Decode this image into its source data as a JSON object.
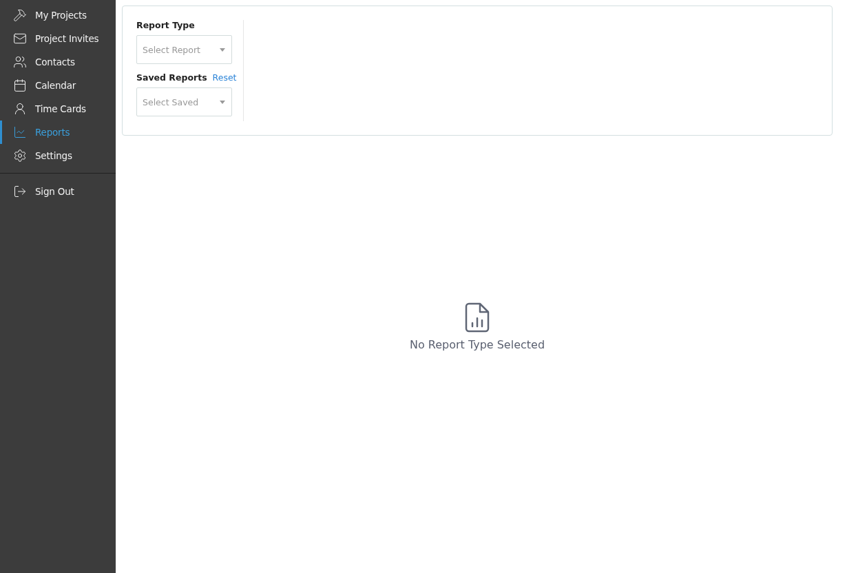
{
  "sidebar": {
    "items": [
      {
        "label": "My Projects",
        "selected": false
      },
      {
        "label": "Project Invites",
        "selected": false
      },
      {
        "label": "Contacts",
        "selected": false
      },
      {
        "label": "Calendar",
        "selected": false
      },
      {
        "label": "Time Cards",
        "selected": false
      },
      {
        "label": "Reports",
        "selected": true
      },
      {
        "label": "Settings",
        "selected": false
      }
    ],
    "sign_out": {
      "label": "Sign Out"
    }
  },
  "filters": {
    "report_type": {
      "label": "Report Type",
      "placeholder": "Select Report"
    },
    "saved_reports": {
      "label": "Saved Reports",
      "reset": "Reset",
      "placeholder": "Select Saved"
    }
  },
  "empty_state": {
    "message": "No Report Type Selected"
  }
}
